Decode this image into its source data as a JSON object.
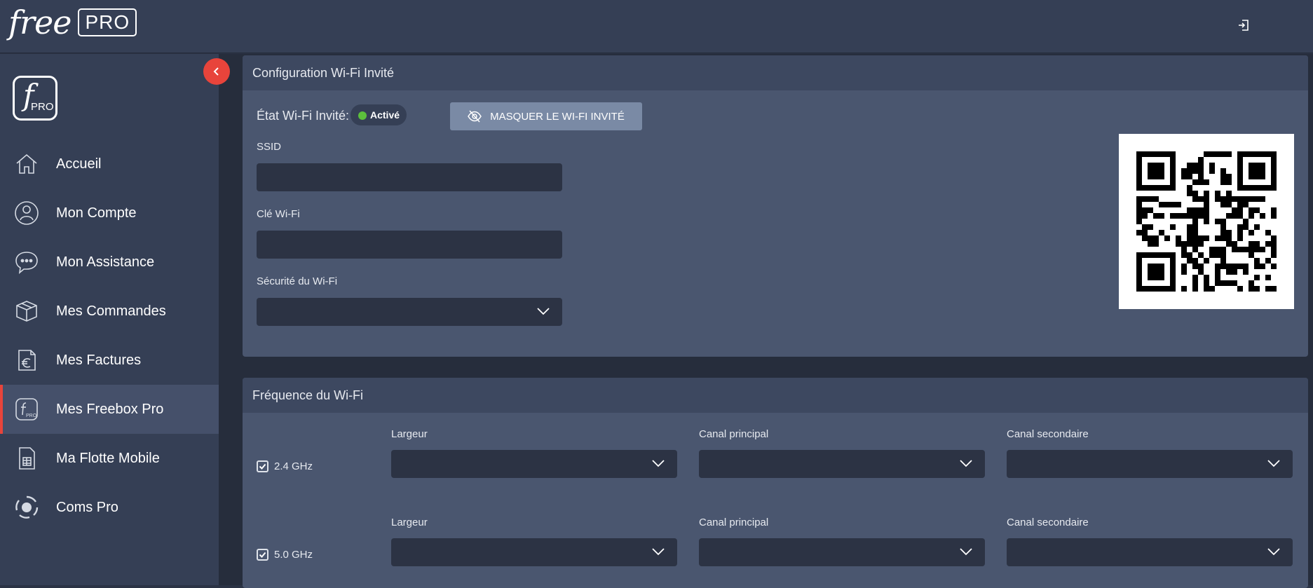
{
  "brand": {
    "logo_text": "free",
    "logo_badge": "PRO",
    "side_logo_f": "f",
    "side_logo_pro": "PRO"
  },
  "header": {
    "logout_icon": "logout-icon"
  },
  "sidebar": {
    "collapse_icon": "chevron-left-icon",
    "items": [
      {
        "label": "Accueil",
        "icon": "home-icon"
      },
      {
        "label": "Mon Compte",
        "icon": "user-icon"
      },
      {
        "label": "Mon Assistance",
        "icon": "chat-icon"
      },
      {
        "label": "Mes Commandes",
        "icon": "box-icon"
      },
      {
        "label": "Mes Factures",
        "icon": "invoice-euro-icon"
      },
      {
        "label": "Mes Freebox Pro",
        "icon": "freebox-pro-icon",
        "active": true
      },
      {
        "label": "Ma Flotte Mobile",
        "icon": "sim-card-icon"
      },
      {
        "label": "Coms Pro",
        "icon": "coms-icon"
      }
    ]
  },
  "guest_wifi": {
    "title": "Configuration Wi-Fi Invité",
    "state_label": "État Wi-Fi Invité:",
    "state_value": "Activé",
    "state_color": "#5cbf3c",
    "hide_button_label": "MASQUER LE WI-FI INVITÉ",
    "ssid_label": "SSID",
    "ssid_value": "",
    "key_label": "Clé Wi-Fi",
    "key_value": "",
    "security_label": "Sécurité du Wi-Fi",
    "security_value": ""
  },
  "frequency": {
    "title": "Fréquence du Wi-Fi",
    "bands": [
      {
        "name": "2.4 GHz",
        "checked": true,
        "width_label": "Largeur",
        "main_channel_label": "Canal principal",
        "secondary_channel_label": "Canal secondaire"
      },
      {
        "name": "5.0 GHz",
        "checked": true,
        "width_label": "Largeur",
        "main_channel_label": "Canal principal",
        "secondary_channel_label": "Canal secondaire"
      }
    ]
  },
  "colors": {
    "accent": "#e8443b",
    "sidebar_bg": "#353f55",
    "card_bg": "#4a566f",
    "field_bg": "#2c3344"
  }
}
